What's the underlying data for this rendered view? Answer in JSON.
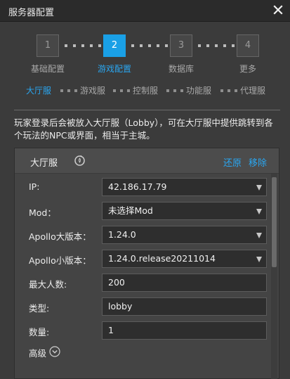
{
  "window": {
    "title": "服务器配置",
    "close_icon": "close-icon"
  },
  "steps": [
    {
      "number": "1",
      "label": "基础配置",
      "active": false
    },
    {
      "number": "2",
      "label": "游戏配置",
      "active": true
    },
    {
      "number": "3",
      "label": "数据库",
      "active": false
    },
    {
      "number": "4",
      "label": "更多",
      "active": false
    }
  ],
  "subtabs": [
    {
      "label": "大厅服",
      "active": true
    },
    {
      "label": "游戏服",
      "active": false
    },
    {
      "label": "控制服",
      "active": false
    },
    {
      "label": "功能服",
      "active": false
    },
    {
      "label": "代理服",
      "active": false
    }
  ],
  "description": "玩家登录后会被放入大厅服（Lobby），可在大厅服中提供跳转到各个玩法的NPC或界面，相当于主城。",
  "panel": {
    "title": "大厅服",
    "restore_label": "还原",
    "remove_label": "移除",
    "fields": [
      {
        "label": "IP:",
        "value": "42.186.17.79",
        "type": "select"
      },
      {
        "label": "Mod：",
        "value": "未选择Mod",
        "type": "select"
      },
      {
        "label": "Apollo大版本：",
        "value": "1.24.0",
        "type": "select"
      },
      {
        "label": "Apollo小版本：",
        "value": "1.24.0.release20211014",
        "type": "select"
      },
      {
        "label": "最大人数:",
        "value": "200",
        "type": "input"
      },
      {
        "label": "类型:",
        "value": "lobby",
        "type": "input"
      },
      {
        "label": "数量:",
        "value": "1",
        "type": "input"
      }
    ],
    "advanced_label": "高级"
  },
  "colors": {
    "accent": "#1aa0e6",
    "link": "#2aa6f0",
    "background": "#3b3b3b",
    "titlebar": "#2b2b2b"
  }
}
